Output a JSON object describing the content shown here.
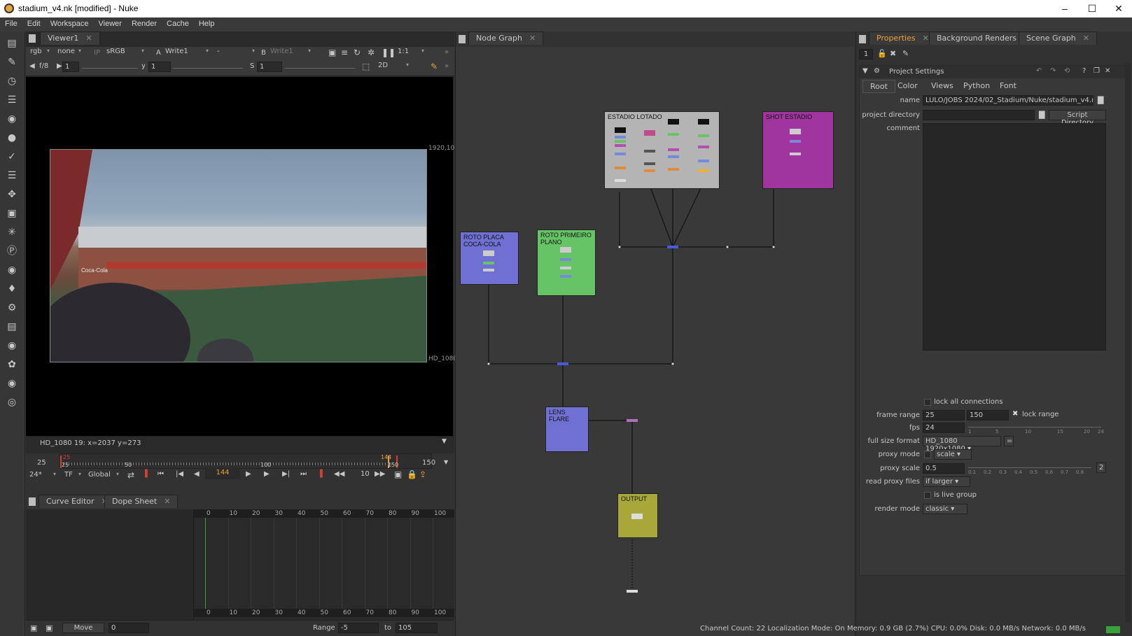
{
  "window": {
    "title": "stadium_v4.nk [modified] - Nuke",
    "minimize": "–",
    "maximize": "☐",
    "close": "✕"
  },
  "menu": [
    "File",
    "Edit",
    "Workspace",
    "Viewer",
    "Render",
    "Cache",
    "Help"
  ],
  "viewer": {
    "tab": "Viewer1",
    "channels": "rgb",
    "alpha": "none",
    "ip": "IP",
    "lut": "sRGB",
    "a_label": "A",
    "a_input": "Write1",
    "b_compare": "-",
    "b_label": "B",
    "b_input": "Write1",
    "zoom": "1:1",
    "fstop": "f/8",
    "gain": "1",
    "y_label": "y",
    "gamma": "1",
    "s_label": "S",
    "sat": "1",
    "mode": "2D",
    "format_top": "1920,1080",
    "format_side": "HD_1080",
    "info": "HD_1080 19:  x=2037 y=273",
    "photo_text": "Coca-Cola"
  },
  "timeline": {
    "start": "25",
    "end": "150",
    "in_mark": "25",
    "out_mark": "150",
    "ticks": [
      "25",
      "50",
      "100",
      "150"
    ],
    "current": "144",
    "current_mark": "144",
    "fps": "24*",
    "tf": "TF",
    "global": "Global",
    "increment": "10"
  },
  "curves": {
    "tabs": [
      "Curve Editor",
      "Dope Sheet"
    ],
    "ruler": [
      "0",
      "10",
      "20",
      "30",
      "40",
      "50",
      "60",
      "70",
      "80",
      "90",
      "100"
    ],
    "move": "Move",
    "move_val": "0",
    "range_label": "Range",
    "range_from": "-5",
    "to": "to",
    "range_to": "105"
  },
  "nodegraph": {
    "tab": "Node Graph",
    "nodes": [
      {
        "label": "ESTADIO LOTADO"
      },
      {
        "label": "SHOT ESTADIO"
      },
      {
        "label": "ROTO PLACA COCA-COLA"
      },
      {
        "label": "ROTO PRIMEIRO PLANO"
      },
      {
        "label": "LENS FLARE"
      },
      {
        "label": "OUTPUT"
      }
    ]
  },
  "properties": {
    "tabs": [
      "Properties",
      "Background Renders",
      "Scene Graph"
    ],
    "max_panels": "1",
    "panel_title": "Project Settings",
    "subtabs": [
      "Root",
      "Color",
      "Views",
      "Python",
      "Font"
    ],
    "name_label": "name",
    "name_value": "LULO/JOBS 2024/02_Stadium/Nuke/stadium_v4.nk",
    "dir_label": "project directory",
    "dir_button": "Script Directory",
    "comment_label": "comment",
    "lock_all": "lock all connections",
    "frame_range_label": "frame range",
    "frame_start": "25",
    "frame_end": "150",
    "lock_range": "lock range",
    "fps_label": "fps",
    "fps_value": "24",
    "fps_ticks": [
      "1",
      "5",
      "10",
      "15",
      "20",
      "24"
    ],
    "format_label": "full size format",
    "format_value": "HD_1080 1920x1080",
    "proxy_mode_label": "proxy mode",
    "proxy_mode_value": "scale",
    "proxy_scale_label": "proxy scale",
    "proxy_scale_value": "0.5",
    "proxy_ticks": [
      "0.1",
      "0.2",
      "0.3",
      "0.4",
      "0.5",
      "0.6",
      "0.7",
      "0.8"
    ],
    "proxy_end": "2",
    "read_proxy_label": "read proxy files",
    "read_proxy_value": "if larger",
    "live_group": "is live group",
    "render_mode_label": "render mode",
    "render_mode_value": "classic"
  },
  "status": "Channel Count: 22  Localization Mode: On  Memory: 0.9 GB (2.7%)  CPU: 0.0%  Disk: 0.0 MB/s  Network: 0.0 MB/s",
  "colors": {
    "accent": "#f0a034",
    "node_grey": "#b4b4b4",
    "node_magenta": "#a035a0",
    "node_blue": "#7070d2",
    "node_green": "#66c466",
    "node_olive": "#a8a83a"
  }
}
